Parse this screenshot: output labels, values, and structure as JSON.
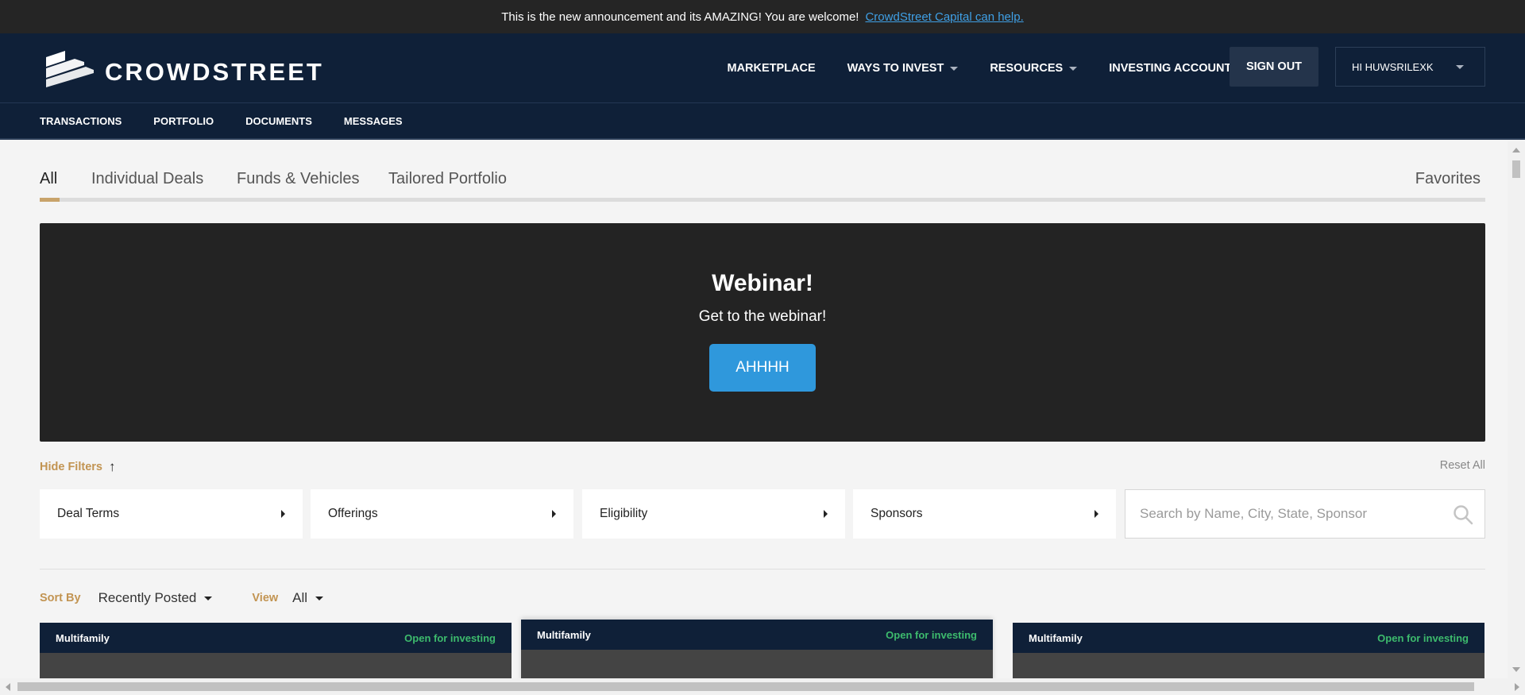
{
  "announcement": {
    "text": "This is the new announcement and its AMAZING! You are welcome!",
    "link_text": "CrowdStreet Capital can help."
  },
  "header": {
    "logo_text": "CROWDSTREET",
    "nav": [
      {
        "label": "MARKETPLACE",
        "has_dropdown": false
      },
      {
        "label": "WAYS TO INVEST",
        "has_dropdown": true
      },
      {
        "label": "RESOURCES",
        "has_dropdown": true
      },
      {
        "label": "INVESTING ACCOUNTS",
        "has_dropdown": false
      }
    ],
    "sign_out": "SIGN OUT",
    "user_greeting": "HI HUWSRILEXK"
  },
  "subnav": {
    "items": [
      "TRANSACTIONS",
      "PORTFOLIO",
      "DOCUMENTS",
      "MESSAGES"
    ]
  },
  "tabs": {
    "items": [
      "All",
      "Individual Deals",
      "Funds & Vehicles",
      "Tailored Portfolio"
    ],
    "active": "All",
    "favorites": "Favorites"
  },
  "webinar": {
    "title": "Webinar!",
    "subtitle": "Get to the webinar!",
    "button": "AHHHH"
  },
  "filters": {
    "hide_label": "Hide Filters",
    "reset_label": "Reset All",
    "items": [
      "Deal Terms",
      "Offerings",
      "Eligibility",
      "Sponsors"
    ],
    "search_placeholder": "Search by Name, City, State, Sponsor"
  },
  "sort": {
    "sort_label": "Sort By",
    "sort_value": "Recently Posted",
    "view_label": "View",
    "view_value": "All"
  },
  "cards": [
    {
      "type": "Multifamily",
      "status": "Open for investing"
    },
    {
      "type": "Multifamily",
      "status": "Open for investing"
    },
    {
      "type": "Multifamily",
      "status": "Open for investing"
    }
  ],
  "colors": {
    "navy": "#0f2038",
    "gold": "#c8a36a",
    "accent_blue": "#2f98dc",
    "status_green": "#3dbb6d"
  }
}
